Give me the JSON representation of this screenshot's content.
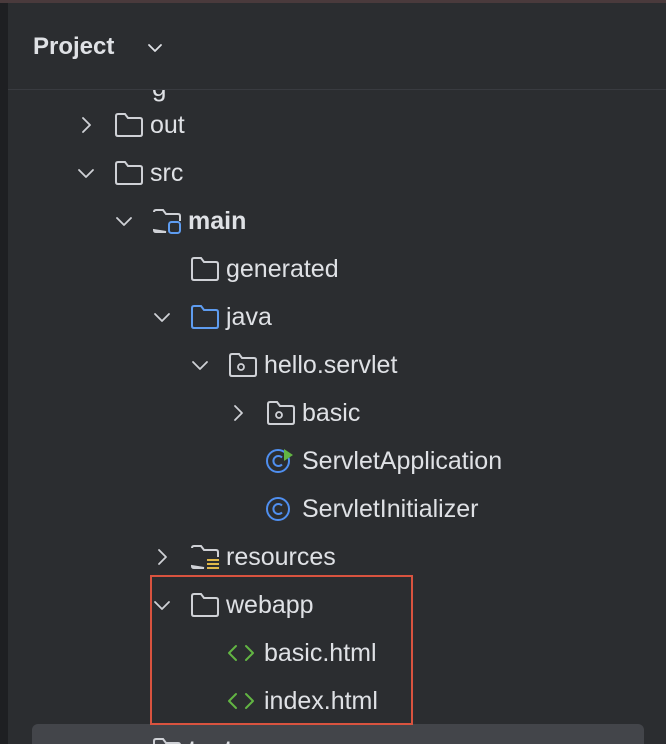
{
  "panel": {
    "title": "Project",
    "partial_top_label": "g"
  },
  "tree": {
    "out": "out",
    "src": "src",
    "main": "main",
    "generated": "generated",
    "java": "java",
    "package": "hello.servlet",
    "basic_pkg": "basic",
    "servlet_application": "ServletApplication",
    "servlet_initializer": "ServletInitializer",
    "resources": "resources",
    "webapp": "webapp",
    "basic_html": "basic.html",
    "index_html": "index.html",
    "test": "test"
  },
  "colors": {
    "background": "#2b2d30",
    "text": "#dfe1e5",
    "folder_icon": "#cfd1d6",
    "source_folder_icon": "#5e9cf0",
    "class_icon": "#4f8ff0",
    "run_marker": "#62b543",
    "html_icon": "#62b543",
    "highlight_border": "#d9533f",
    "resources_marker": "#e0b84a"
  }
}
